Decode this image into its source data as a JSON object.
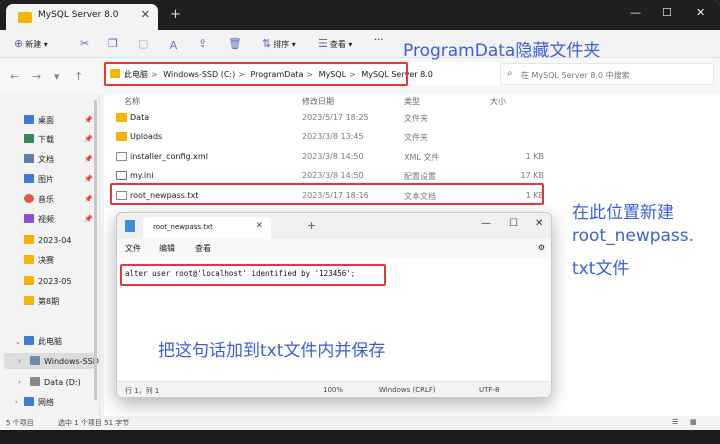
{
  "window": {
    "tab_title": "MySQL Server 8.0",
    "close_glyph": "✕",
    "add_glyph": "+",
    "min_glyph": "—",
    "max_glyph": "☐"
  },
  "toolbar": {
    "new_label": "新建",
    "sort_label": "排序",
    "view_label": "查看",
    "more_label": "···"
  },
  "nav": {
    "back": "←",
    "forward": "→",
    "up": "↑",
    "breadcrumb": [
      "此电脑",
      "Windows-SSD (C:)",
      "ProgramData",
      "MySQL",
      "MySQL Server 8.0"
    ],
    "breadcrumb_sep": ">",
    "search_placeholder": "在 MySQL Server 8.0 中搜索"
  },
  "sidebar": {
    "items": [
      {
        "label": "桌面",
        "color": "#3a7bd5"
      },
      {
        "label": "下载",
        "color": "#2e8b57"
      },
      {
        "label": "文档",
        "color": "#5a7fa8"
      },
      {
        "label": "图片",
        "color": "#3a7bd5"
      },
      {
        "label": "音乐",
        "color": "#e25b3c"
      },
      {
        "label": "视频",
        "color": "#8a4fd0"
      },
      {
        "label": "2023-04",
        "color": "#f4b400"
      },
      {
        "label": "决赛",
        "color": "#f4b400"
      },
      {
        "label": "2023-05",
        "color": "#f4b400"
      },
      {
        "label": "第8期",
        "color": "#f4b400"
      }
    ],
    "this_pc": "此电脑",
    "windows_ssd": "Windows-SSD",
    "data_d": "Data (D:)",
    "network": "网络"
  },
  "columns": {
    "name": "名称",
    "date": "修改日期",
    "type": "类型",
    "size": "大小"
  },
  "files": [
    {
      "name": "Data",
      "date": "2023/5/17 18:25",
      "type": "文件夹",
      "size": "",
      "icon": "folder-icon"
    },
    {
      "name": "Uploads",
      "date": "2023/3/8 13:45",
      "type": "文件夹",
      "size": "",
      "icon": "folder-icon"
    },
    {
      "name": "installer_config.xml",
      "date": "2023/3/8 14:50",
      "type": "XML 文件",
      "size": "1 KB",
      "icon": "document-icon"
    },
    {
      "name": "my.ini",
      "date": "2023/3/8 14:50",
      "type": "配置设置",
      "size": "17 KB",
      "icon": "settings-file-icon"
    },
    {
      "name": "root_newpass.txt",
      "date": "2023/5/17 18:16",
      "type": "文本文档",
      "size": "1 KB",
      "icon": "text-file-icon"
    }
  ],
  "status": {
    "count": "5 个项目",
    "selected": "选中 1 个项目  51 字节"
  },
  "notepad": {
    "tab_title": "root_newpass.txt",
    "menu_file": "文件",
    "menu_edit": "编辑",
    "menu_view": "查看",
    "content": "alter user root@'localhost' identified by '123456';",
    "pos": "行 1，列 1",
    "zoom": "100%",
    "eol": "Windows (CRLF)",
    "encoding": "UTF-8"
  },
  "annotations": {
    "programdata": "ProgramData隐藏文件夹",
    "newfile_line1": "在此位置新建",
    "newfile_line2": "root_newpass.",
    "newfile_line3": "txt文件",
    "save": "把这句话加到txt文件内并保存"
  },
  "colors": {
    "highlight": "#e53935",
    "annotation": "#3a5fd9",
    "folder": "#f4b400"
  }
}
